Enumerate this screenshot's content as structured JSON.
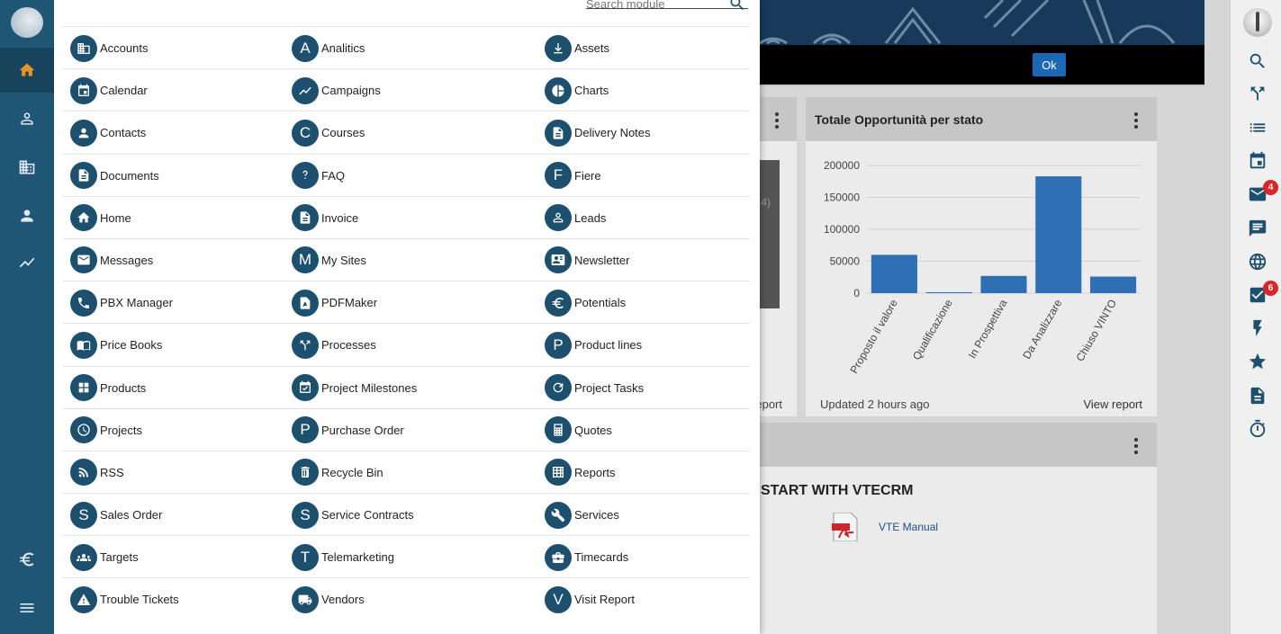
{
  "search": {
    "placeholder": "Search module"
  },
  "modules": [
    [
      {
        "label": "Accounts",
        "icon": "building-icon"
      },
      {
        "label": "Analitics",
        "icon": "letter-a-icon",
        "letter": "A"
      },
      {
        "label": "Assets",
        "icon": "download-icon"
      }
    ],
    [
      {
        "label": "Calendar",
        "icon": "calendar-icon"
      },
      {
        "label": "Campaigns",
        "icon": "line-chart-icon"
      },
      {
        "label": "Charts",
        "icon": "pie-chart-icon"
      }
    ],
    [
      {
        "label": "Contacts",
        "icon": "person-icon"
      },
      {
        "label": "Courses",
        "icon": "letter-c-icon",
        "letter": "C"
      },
      {
        "label": "Delivery Notes",
        "icon": "document-icon"
      }
    ],
    [
      {
        "label": "Documents",
        "icon": "document-icon"
      },
      {
        "label": "FAQ",
        "icon": "question-icon"
      },
      {
        "label": "Fiere",
        "icon": "letter-f-icon",
        "letter": "F"
      }
    ],
    [
      {
        "label": "Home",
        "icon": "home-icon"
      },
      {
        "label": "Invoice",
        "icon": "document-icon"
      },
      {
        "label": "Leads",
        "icon": "person-outline-icon"
      }
    ],
    [
      {
        "label": "Messages",
        "icon": "mail-icon"
      },
      {
        "label": "My Sites",
        "icon": "letter-m-icon",
        "letter": "M"
      },
      {
        "label": "Newsletter",
        "icon": "contact-card-icon"
      }
    ],
    [
      {
        "label": "PBX Manager",
        "icon": "phone-icon"
      },
      {
        "label": "PDFMaker",
        "icon": "pdf-icon"
      },
      {
        "label": "Potentials",
        "icon": "euro-icon"
      }
    ],
    [
      {
        "label": "Price Books",
        "icon": "book-icon"
      },
      {
        "label": "Processes",
        "icon": "fork-icon"
      },
      {
        "label": "Product lines",
        "icon": "letter-p-icon",
        "letter": "P"
      }
    ],
    [
      {
        "label": "Products",
        "icon": "grid-icon"
      },
      {
        "label": "Project Milestones",
        "icon": "calendar-check-icon"
      },
      {
        "label": "Project Tasks",
        "icon": "refresh-icon"
      }
    ],
    [
      {
        "label": "Projects",
        "icon": "clock-icon"
      },
      {
        "label": "Purchase Order",
        "icon": "letter-p-icon",
        "letter": "P"
      },
      {
        "label": "Quotes",
        "icon": "calculator-icon"
      }
    ],
    [
      {
        "label": "RSS",
        "icon": "rss-icon"
      },
      {
        "label": "Recycle Bin",
        "icon": "trash-icon"
      },
      {
        "label": "Reports",
        "icon": "table-icon"
      }
    ],
    [
      {
        "label": "Sales Order",
        "icon": "letter-s-icon",
        "letter": "S"
      },
      {
        "label": "Service Contracts",
        "icon": "letter-s-icon",
        "letter": "S"
      },
      {
        "label": "Services",
        "icon": "wrench-icon"
      }
    ],
    [
      {
        "label": "Targets",
        "icon": "group-icon"
      },
      {
        "label": "Telemarketing",
        "icon": "letter-t-icon",
        "letter": "T"
      },
      {
        "label": "Timecards",
        "icon": "briefcase-icon"
      }
    ],
    [
      {
        "label": "Trouble Tickets",
        "icon": "warning-icon"
      },
      {
        "label": "Vendors",
        "icon": "truck-icon"
      },
      {
        "label": "Visit Report",
        "icon": "letter-v-icon",
        "letter": "V"
      }
    ]
  ],
  "dashboard": {
    "ok_label": "Ok",
    "left_widget": {
      "partial_value": "4)",
      "partial_link": "eport"
    },
    "chart_widget": {
      "title": "Totale Opportunità per stato",
      "updated": "Updated 2 hours ago",
      "view_report": "View report"
    },
    "bottom_widget": {
      "title": "START WITH VTECRM",
      "link": "VTE Manual"
    }
  },
  "right_rail": {
    "badges": {
      "mail": "4",
      "tasks": "6"
    },
    "icons": [
      "search-icon",
      "fork-icon",
      "list-icon",
      "calendar-icon",
      "mail-icon",
      "chat-icon",
      "globe-icon",
      "checkbox-icon",
      "lightning-icon",
      "star-icon",
      "document-icon",
      "timer-icon"
    ]
  },
  "colors": {
    "brand": "#1d4f6e",
    "sidebar": "#1f5675",
    "bar": "#2f6fb4",
    "badge": "#d9262b",
    "home_active": "#e8922c"
  },
  "chart_data": {
    "type": "bar",
    "title": "Totale Opportunità per stato",
    "categories": [
      "Proposto il valore",
      "Qualificazione",
      "In Prospettiva",
      "Da Analizzare",
      "Chiuso VINTO"
    ],
    "values": [
      60000,
      1500,
      27000,
      183000,
      26000
    ],
    "yticks": [
      0,
      50000,
      100000,
      150000,
      200000
    ],
    "ylim": [
      0,
      200000
    ],
    "grid": true
  }
}
